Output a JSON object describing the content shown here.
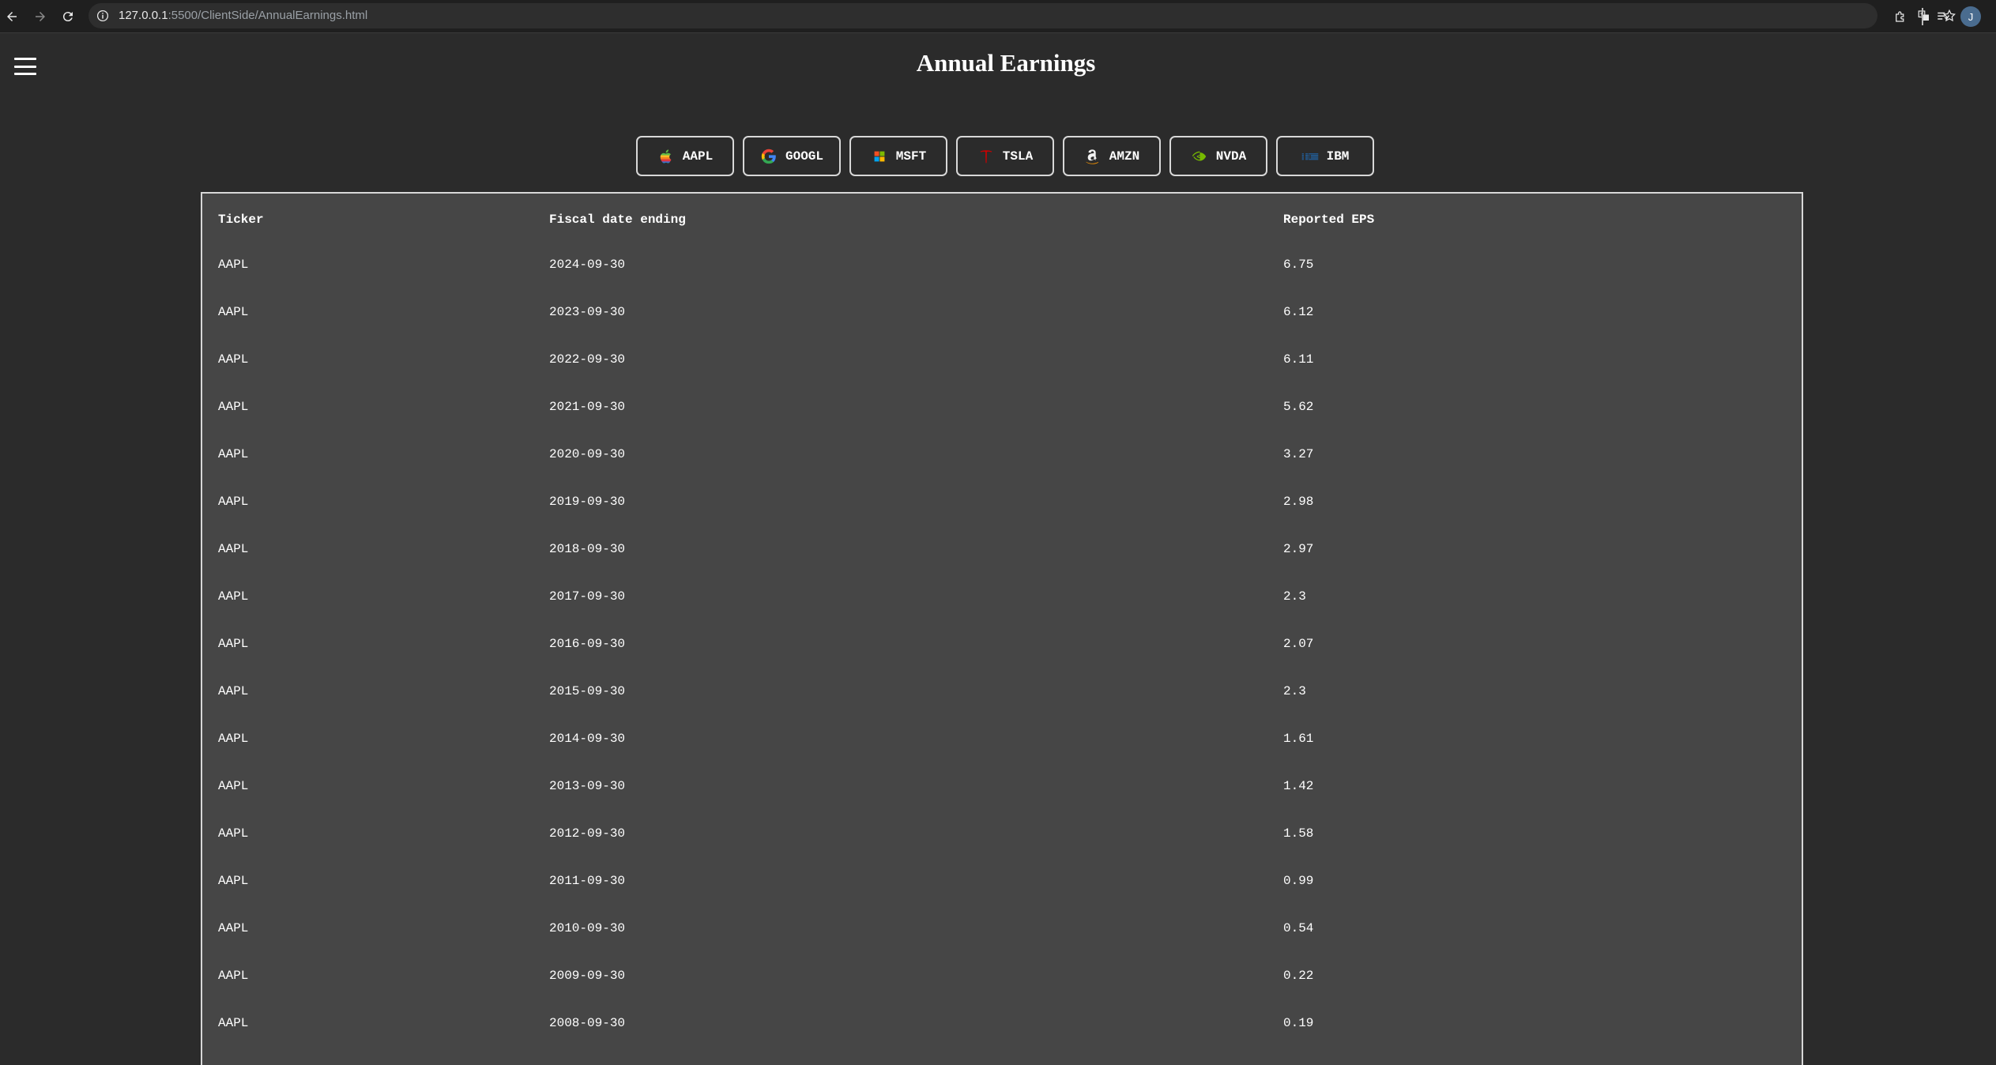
{
  "browser": {
    "url_host": "127.0.0.1",
    "url_rest": ":5500/ClientSide/AnnualEarnings.html",
    "profile_initial": "J"
  },
  "page": {
    "title": "Annual Earnings"
  },
  "tickers": [
    {
      "label": "AAPL",
      "icon": "apple-logo-icon"
    },
    {
      "label": "GOOGL",
      "icon": "google-logo-icon"
    },
    {
      "label": "MSFT",
      "icon": "microsoft-logo-icon"
    },
    {
      "label": "TSLA",
      "icon": "tesla-logo-icon"
    },
    {
      "label": "AMZN",
      "icon": "amazon-logo-icon"
    },
    {
      "label": "NVDA",
      "icon": "nvidia-logo-icon"
    },
    {
      "label": "IBM",
      "icon": "ibm-logo-icon"
    }
  ],
  "table": {
    "headers": [
      "Ticker",
      "Fiscal date ending",
      "Reported EPS"
    ],
    "rows": [
      [
        "AAPL",
        "2024-09-30",
        "6.75"
      ],
      [
        "AAPL",
        "2023-09-30",
        "6.12"
      ],
      [
        "AAPL",
        "2022-09-30",
        "6.11"
      ],
      [
        "AAPL",
        "2021-09-30",
        "5.62"
      ],
      [
        "AAPL",
        "2020-09-30",
        "3.27"
      ],
      [
        "AAPL",
        "2019-09-30",
        "2.98"
      ],
      [
        "AAPL",
        "2018-09-30",
        "2.97"
      ],
      [
        "AAPL",
        "2017-09-30",
        "2.3"
      ],
      [
        "AAPL",
        "2016-09-30",
        "2.07"
      ],
      [
        "AAPL",
        "2015-09-30",
        "2.3"
      ],
      [
        "AAPL",
        "2014-09-30",
        "1.61"
      ],
      [
        "AAPL",
        "2013-09-30",
        "1.42"
      ],
      [
        "AAPL",
        "2012-09-30",
        "1.58"
      ],
      [
        "AAPL",
        "2011-09-30",
        "0.99"
      ],
      [
        "AAPL",
        "2010-09-30",
        "0.54"
      ],
      [
        "AAPL",
        "2009-09-30",
        "0.22"
      ],
      [
        "AAPL",
        "2008-09-30",
        "0.19"
      ]
    ]
  },
  "colors": {
    "page_background": "#2b2b2b",
    "table_background": "#464646",
    "border": "#d8d8d8",
    "text": "#ffffff"
  }
}
